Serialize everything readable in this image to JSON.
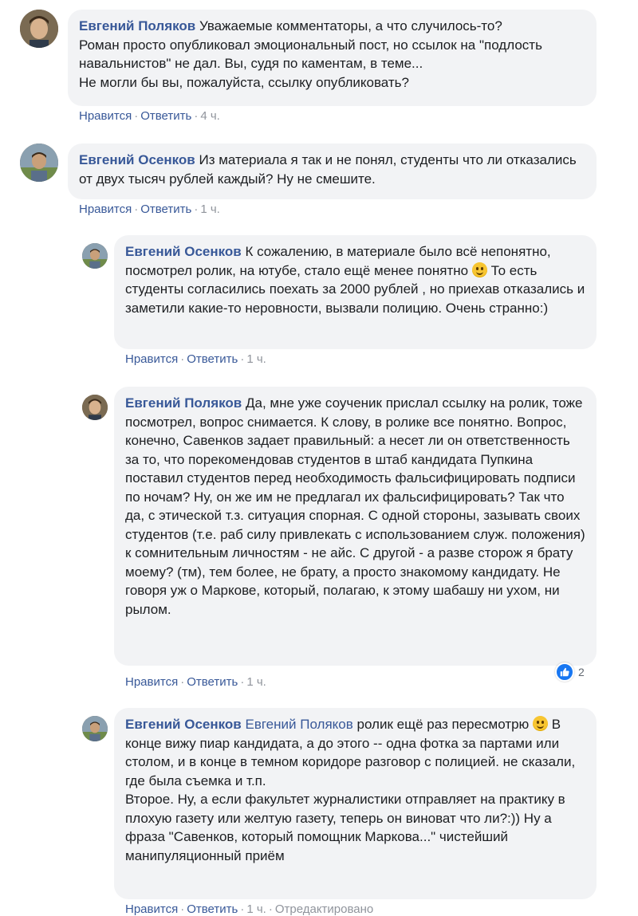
{
  "actions": {
    "like": "Нравится",
    "reply": "Ответить",
    "separator": "·"
  },
  "comments": [
    {
      "author": "Евгений Поляков",
      "text": "Уважаемые комментаторы, а что случилось-то?\nРоман просто опубликовал эмоциональный пост, но ссылок на \"подлость навальнистов\" не дал. Вы, судя по каментам, в теме...\nНе могли бы вы, пожалуйста, ссылку опубликовать?",
      "time": "4 ч."
    },
    {
      "author": "Евгений Осенков",
      "text": "Из материала я так и не понял, студенты что ли отказались от двух тысяч рублей каждый? Ну не смешите.",
      "time": "1 ч."
    },
    {
      "author": "Евгений Осенков",
      "text_before_emoji": "К сожалению, в материале было всё непонятно, посмотрел ролик, на ютубе, стало ещё менее понятно",
      "text_after_emoji": "То есть студенты согласились поехать за 2000 рублей , но приехав отказались и заметили какие-то неровности, вызвали полицию. Очень странно:)",
      "time": "1 ч."
    },
    {
      "author": "Евгений Поляков",
      "text": "Да, мне уже соученик прислал ссылку на ролик, тоже посмотрел, вопрос снимается. К слову, в ролике все понятно. Вопрос, конечно, Савенков задает правильный: а несет ли он ответственность за то, что порекомендовав студентов в штаб кандидата Пупкина поставил студентов перед необходимость фальсифицировать подписи по ночам? Ну, он же им не предлагал их фальсифицировать? Так что да, с этической т.з. ситуация спорная. С одной стороны, зазывать своих студентов (т.е. раб силу привлекать с использованием служ. положения) к сомнительным личностям - не айс. С другой - а разве сторож я брату моему? (тм), тем более, не брату, а просто знакомому кандидату. Не говоря уж о Маркове, который, полагаю, к этому шабашу ни ухом, ни рылом.",
      "time": "1 ч.",
      "reactions": "2"
    },
    {
      "author": "Евгений Осенков",
      "mention": "Евгений Поляков",
      "text_before_emoji": "ролик ещё раз пересмотрю",
      "text_after_emoji": "В конце вижу пиар кандидата, а до этого -- одна фотка за партами или столом, и в конце в темном коридоре разговор с полицией. не сказали, где была съемка и т.п.\nВторое. Ну, а если факультет журналистики отправляет на практику в плохую газету или желтую газету, теперь он виноват что ли?:)) Ну а фраза \"Савенков, который помощник Маркова...\" чистейший манипуляционный приём",
      "time": "1 ч.",
      "edited": "Отредактировано"
    }
  ]
}
